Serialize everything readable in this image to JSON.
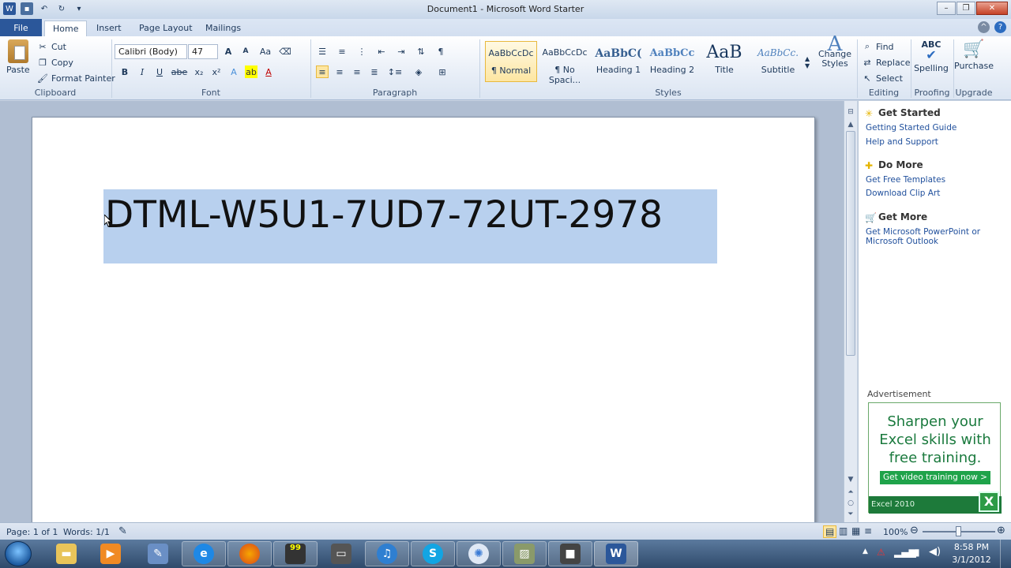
{
  "window": {
    "title": "Document1 - Microsoft Word Starter"
  },
  "tabs": {
    "file": "File",
    "home": "Home",
    "insert": "Insert",
    "page_layout": "Page Layout",
    "mailings": "Mailings"
  },
  "clipboard": {
    "paste": "Paste",
    "cut": "Cut",
    "copy": "Copy",
    "format_painter": "Format Painter",
    "label": "Clipboard"
  },
  "font": {
    "family": "Calibri (Body)",
    "size": "47",
    "label": "Font",
    "bold": "B",
    "italic": "I",
    "underline": "U",
    "strike": "abe",
    "subscript": "x₂",
    "superscript": "x²"
  },
  "paragraph": {
    "label": "Paragraph",
    "pilcrow": "¶"
  },
  "styles": {
    "label": "Styles",
    "items": [
      {
        "sample": "AaBbCcDc",
        "name": "¶ Normal"
      },
      {
        "sample": "AaBbCcDc",
        "name": "¶ No Spaci..."
      },
      {
        "sample": "AaBbC(",
        "name": "Heading 1"
      },
      {
        "sample": "AaBbCc",
        "name": "Heading 2"
      },
      {
        "sample": "AaB",
        "name": "Title"
      },
      {
        "sample": "AaBbCc.",
        "name": "Subtitle"
      }
    ],
    "change_styles": "Change Styles"
  },
  "editing": {
    "find": "Find",
    "replace": "Replace",
    "select": "Select",
    "label": "Editing"
  },
  "proofing": {
    "spelling": "Spelling",
    "label": "Proofing",
    "abc": "ABC"
  },
  "upgrade": {
    "purchase": "Purchase",
    "label": "Upgrade"
  },
  "document": {
    "text": "DTML-W5U1-7UD7-72UT-2978"
  },
  "sidepane": {
    "get_started": "Get Started",
    "getting_started_guide": "Getting Started Guide",
    "help_support": "Help and Support",
    "do_more": "Do More",
    "free_templates": "Get Free Templates",
    "clip_art": "Download Clip Art",
    "get_more": "Get More",
    "get_ms": "Get Microsoft PowerPoint or Microsoft Outlook",
    "ad_label": "Advertisement",
    "ad_text": "Sharpen your Excel skills with free training.",
    "ad_button": "Get video training now >",
    "ad_brand": "Excel 2010"
  },
  "status": {
    "page": "Page: 1 of 1",
    "words": "Words: 1/1",
    "zoom": "100%"
  },
  "taskbar": {
    "time": "8:58 PM",
    "date": "3/1/2012",
    "badge": "99"
  },
  "colors": {
    "file_tab": "#2b579a",
    "selection": "#b8d0ee",
    "ad_green": "#1b7a3e",
    "link": "#1f4f9c"
  }
}
